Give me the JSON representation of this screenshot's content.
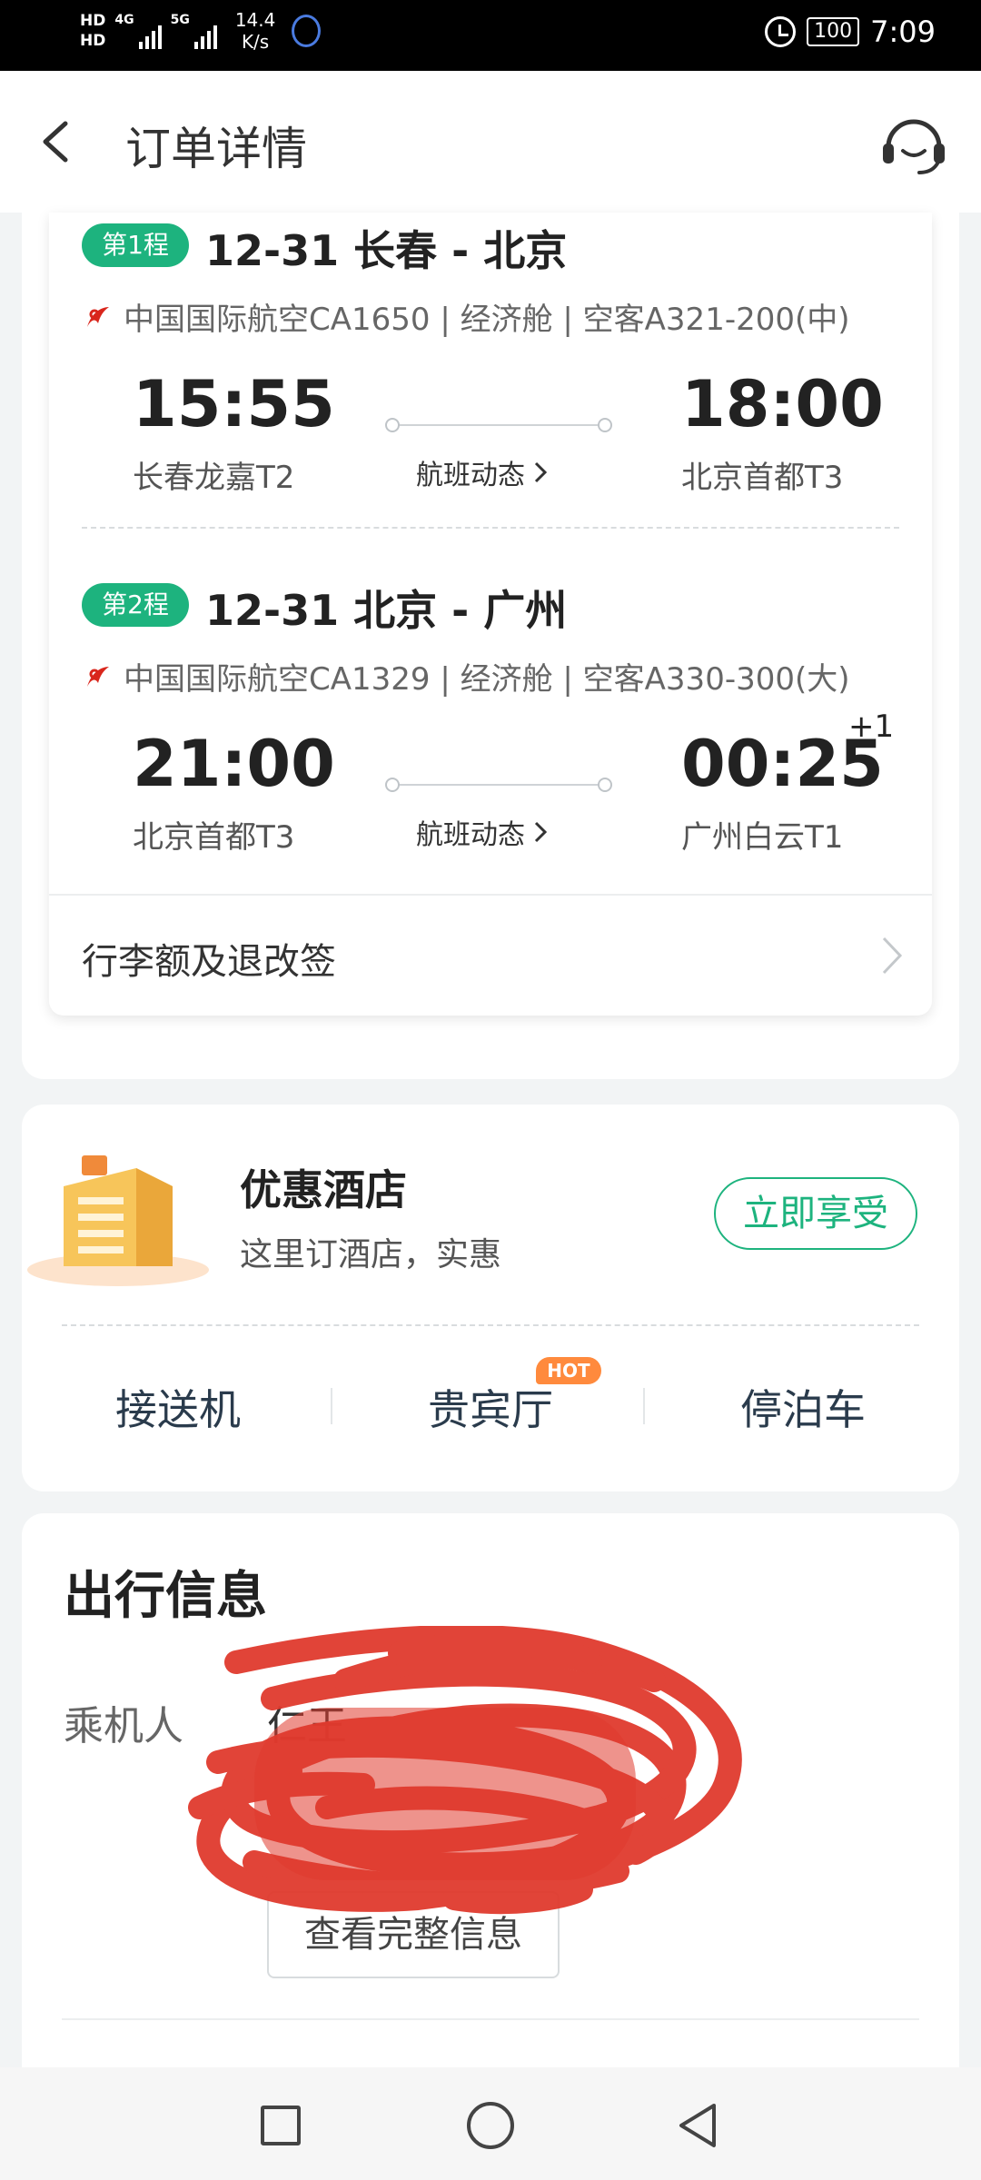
{
  "status_bar": {
    "hd1": "HD",
    "hd2": "HD",
    "net1": "4G",
    "net2": "5G",
    "speed_value": "14.4",
    "speed_unit": "K/s",
    "battery": "100",
    "time": "7:09"
  },
  "header": {
    "title": "订单详情",
    "back_icon": "chevron-left-icon",
    "service_icon": "headset-icon"
  },
  "legs": [
    {
      "badge": "第1程",
      "route": "12-31 长春 - 北京",
      "airline_info": "中国国际航空CA1650 | 经济舱 | 空客A321-200(中)",
      "dep_time": "15:55",
      "dep_airport": "长春龙嘉T2",
      "arr_time": "18:00",
      "arr_airport": "北京首都T3",
      "status_link": "航班动态",
      "plus_day": ""
    },
    {
      "badge": "第2程",
      "route": "12-31 北京 - 广州",
      "airline_info": "中国国际航空CA1329 | 经济舱 | 空客A330-300(大)",
      "dep_time": "21:00",
      "dep_airport": "北京首都T3",
      "arr_time": "00:25",
      "arr_airport": "广州白云T1",
      "status_link": "航班动态",
      "plus_day": "+1"
    }
  ],
  "baggage": {
    "label": "行李额及退改签"
  },
  "hotel": {
    "title": "优惠酒店",
    "desc": "这里订酒店，实惠",
    "button": "立即享受"
  },
  "services": {
    "items": [
      "接送机",
      "贵宾厅",
      "停泊车"
    ],
    "hot_badge": "HOT"
  },
  "travel_info": {
    "title": "出行信息",
    "passenger_label": "乘机人",
    "passenger_value": "仁王",
    "view_full_button": "查看完整信息"
  },
  "colors": {
    "accent_green": "#1db37e",
    "hot_orange": "#ff8a3d",
    "scribble_red": "#e03a2e"
  }
}
